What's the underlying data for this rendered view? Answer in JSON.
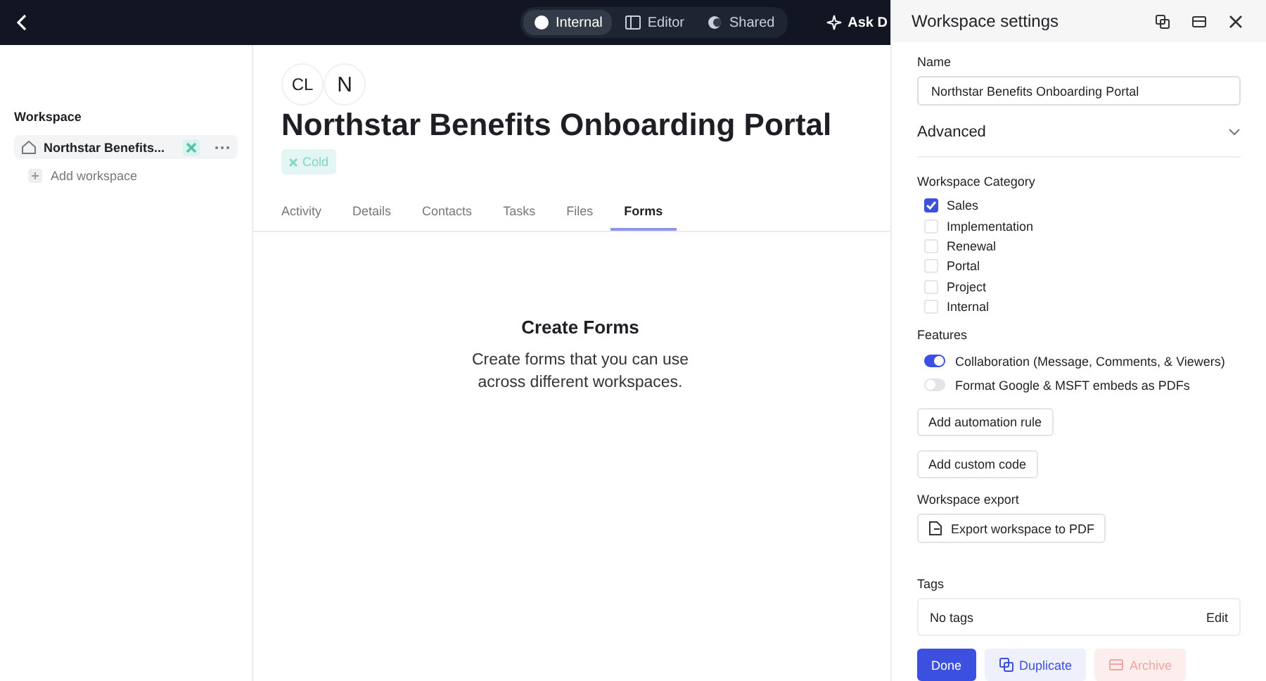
{
  "topbar": {
    "modes": [
      {
        "label": "Internal",
        "selected": true
      },
      {
        "label": "Editor",
        "selected": false
      },
      {
        "label": "Shared",
        "selected": false
      }
    ],
    "ask": "Ask D"
  },
  "sidebar": {
    "title": "Workspace",
    "items": [
      {
        "label": "Northstar Benefits...",
        "selected": true
      }
    ],
    "add": "Add workspace"
  },
  "workspace": {
    "avatars": [
      "CL",
      "N"
    ],
    "title": "Northstar Benefits Onboarding Portal",
    "tag": "Cold",
    "tabs": [
      {
        "label": "Activity",
        "selected": false
      },
      {
        "label": "Details",
        "selected": false
      },
      {
        "label": "Contacts",
        "selected": false
      },
      {
        "label": "Tasks",
        "selected": false
      },
      {
        "label": "Files",
        "selected": false
      },
      {
        "label": "Forms",
        "selected": true
      }
    ],
    "empty": {
      "title": "Create Forms",
      "text": "Create forms that you can use across different workspaces."
    }
  },
  "settings": {
    "title": "Workspace settings",
    "name_label": "Name",
    "name_value": "Northstar Benefits Onboarding Portal",
    "advanced": "Advanced",
    "expanded": true,
    "category_label": "Workspace Category",
    "categories": [
      {
        "label": "Sales",
        "checked": true
      },
      {
        "label": "Implementation",
        "checked": false
      },
      {
        "label": "Renewal",
        "checked": false
      },
      {
        "label": "Portal",
        "checked": false
      },
      {
        "label": "Project",
        "checked": false
      },
      {
        "label": "Internal",
        "checked": false
      }
    ],
    "features_label": "Features",
    "features": [
      {
        "label": "Collaboration (Message, Comments, & Viewers)",
        "on": true
      },
      {
        "label": "Format Google & MSFT embeds as PDFs",
        "on": false
      }
    ],
    "actions": [
      "Add automation rule",
      "Add custom code"
    ],
    "export_label": "Workspace export",
    "export_button": "Export workspace to PDF",
    "tags_label": "Tags",
    "tags_value": "No tags",
    "tags_edit": "Edit",
    "footer": [
      {
        "label": "Done",
        "kind": "primary"
      },
      {
        "label": "Duplicate",
        "kind": "secondary"
      },
      {
        "label": "Archive",
        "kind": "danger"
      }
    ]
  }
}
